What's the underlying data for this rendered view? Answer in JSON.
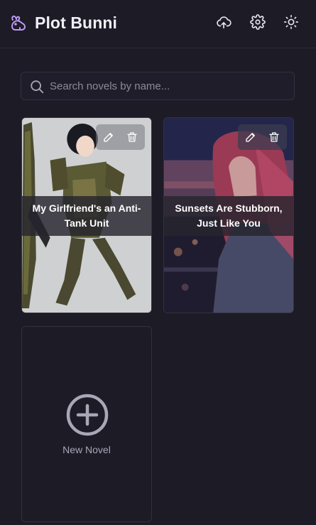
{
  "header": {
    "title": "Plot Bunni",
    "logo_icon": "rabbit-icon",
    "actions": [
      {
        "name": "cloud-upload-icon"
      },
      {
        "name": "gear-icon"
      },
      {
        "name": "sun-icon"
      }
    ]
  },
  "search": {
    "placeholder": "Search novels by name...",
    "value": ""
  },
  "novels": [
    {
      "title": "My Girlfriend's an Anti-Tank Unit"
    },
    {
      "title": "Sunsets Are Stubborn, Just Like You"
    }
  ],
  "new_novel": {
    "label": "New Novel"
  },
  "colors": {
    "background": "#1d1b26",
    "accent": "#b89af0",
    "border": "#34313f"
  }
}
